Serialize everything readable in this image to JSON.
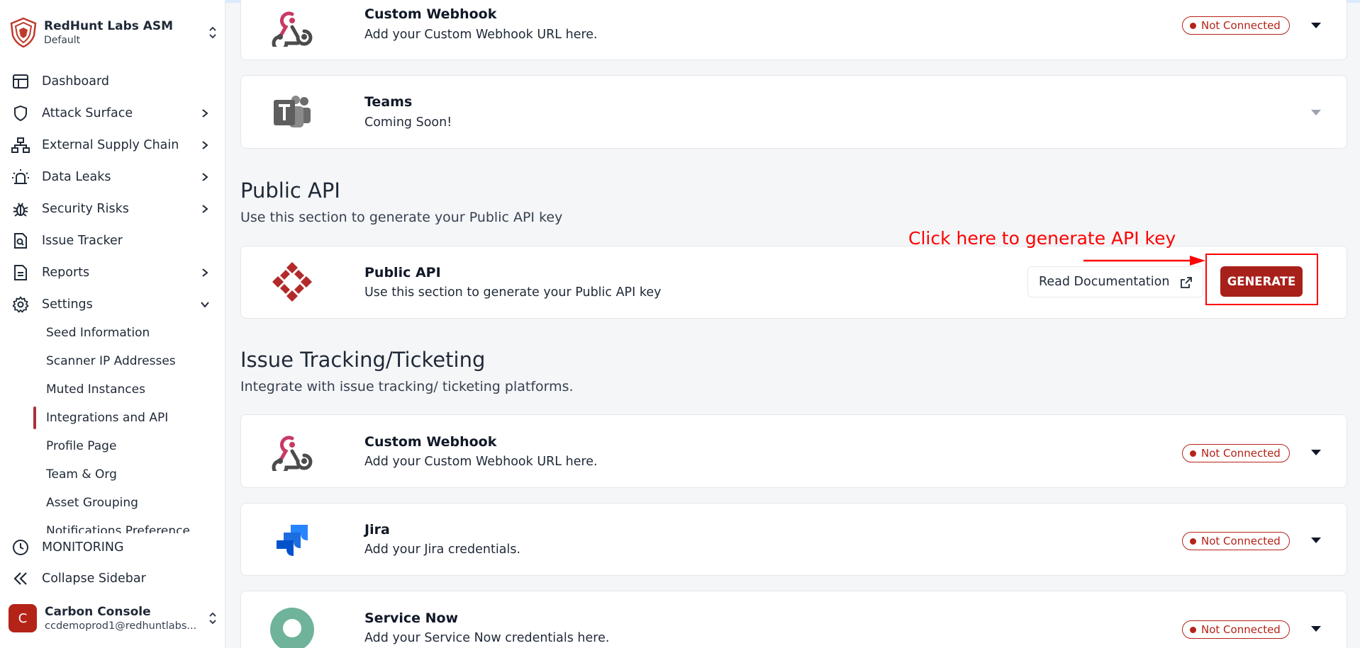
{
  "org": {
    "name": "RedHunt Labs ASM",
    "subtitle": "Default"
  },
  "nav": [
    {
      "label": "Dashboard"
    },
    {
      "label": "Attack Surface"
    },
    {
      "label": "External Supply Chain"
    },
    {
      "label": "Data Leaks"
    },
    {
      "label": "Security Risks"
    },
    {
      "label": "Issue Tracker"
    },
    {
      "label": "Reports"
    },
    {
      "label": "Settings"
    }
  ],
  "settings_sub": [
    {
      "label": "Seed Information"
    },
    {
      "label": "Scanner IP Addresses"
    },
    {
      "label": "Muted Instances"
    },
    {
      "label": "Integrations and API",
      "active": true
    },
    {
      "label": "Profile Page"
    },
    {
      "label": "Team & Org"
    },
    {
      "label": "Asset Grouping"
    },
    {
      "label": "Notifications Preference"
    }
  ],
  "monitoring_label": "MONITORING",
  "collapse_label": "Collapse Sidebar",
  "user": {
    "initial": "C",
    "name": "Carbon Console",
    "email": "ccdemoprod1@redhuntlabs..."
  },
  "status_not_connected": "Not Connected",
  "top_cards": [
    {
      "title": "Custom Webhook",
      "desc": "Add your Custom Webhook URL here."
    },
    {
      "title": "Teams",
      "desc": "Coming Soon!"
    }
  ],
  "public_api": {
    "section_title": "Public API",
    "section_sub": "Use this section to generate your Public API key",
    "card_title": "Public API",
    "card_desc": "Use this section to generate your Public API key",
    "doc_button": "Read Documentation",
    "generate_button": "GENERATE",
    "annotation": "Click here to generate API key"
  },
  "issue_tracking": {
    "section_title": "Issue Tracking/Ticketing",
    "section_sub": "Integrate with issue tracking/ ticketing platforms.",
    "cards": [
      {
        "title": "Custom Webhook",
        "desc": "Add your Custom Webhook URL here."
      },
      {
        "title": "Jira",
        "desc": "Add your Jira credentials."
      },
      {
        "title": "Service Now",
        "desc": "Add your Service Now credentials here."
      }
    ]
  },
  "colors": {
    "brand": "#a8201a",
    "badge_red": "#b42318",
    "annotation_red": "#ff0000"
  }
}
